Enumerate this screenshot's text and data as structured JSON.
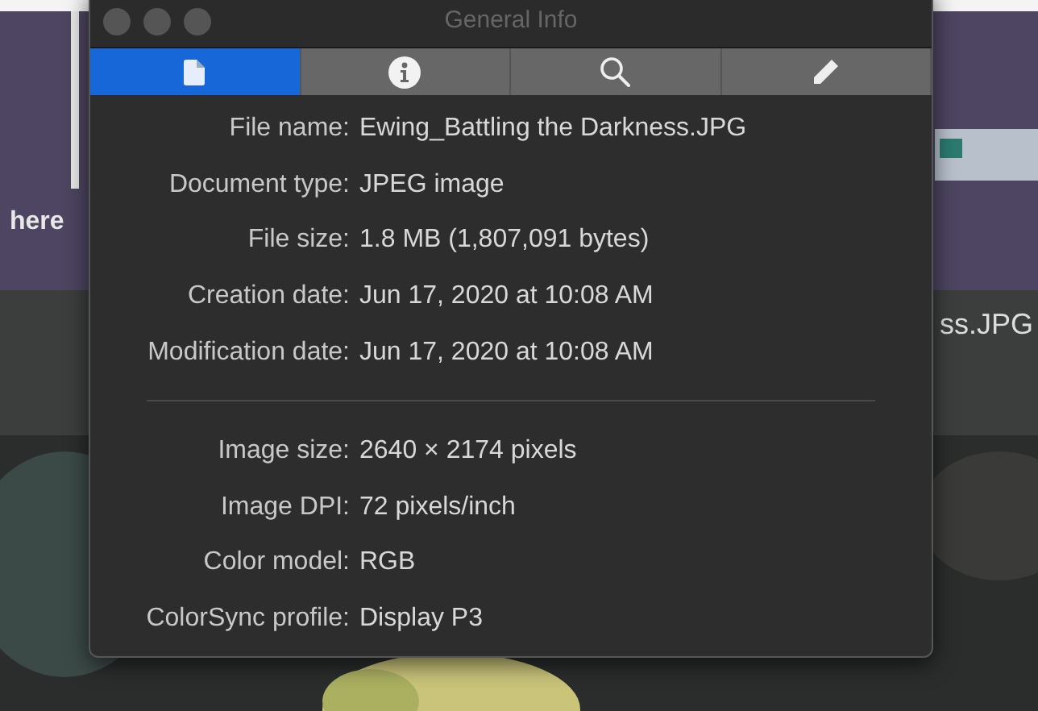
{
  "background": {
    "caption_left": "here",
    "caption_right": "ss.JPG"
  },
  "window": {
    "title": "General Info"
  },
  "tabs": [
    {
      "kind": "document",
      "selected": true
    },
    {
      "kind": "info",
      "selected": false
    },
    {
      "kind": "search",
      "selected": false
    },
    {
      "kind": "pencil",
      "selected": false
    }
  ],
  "sections": [
    {
      "rows": [
        {
          "label": "File name:",
          "value": "Ewing_Battling the Darkness.JPG"
        },
        {
          "label": "Document type:",
          "value": "JPEG image"
        },
        {
          "label": "File size:",
          "value": "1.8 MB (1,807,091 bytes)"
        },
        {
          "label": "Creation date:",
          "value": "Jun 17, 2020 at 10:08 AM"
        },
        {
          "label": "Modification date:",
          "value": "Jun 17, 2020 at 10:08 AM"
        }
      ]
    },
    {
      "rows": [
        {
          "label": "Image size:",
          "value": "2640 × 2174 pixels"
        },
        {
          "label": "Image DPI:",
          "value": "72 pixels/inch"
        },
        {
          "label": "Color model:",
          "value": "RGB"
        },
        {
          "label": "ColorSync profile:",
          "value": "Display P3"
        }
      ]
    }
  ]
}
